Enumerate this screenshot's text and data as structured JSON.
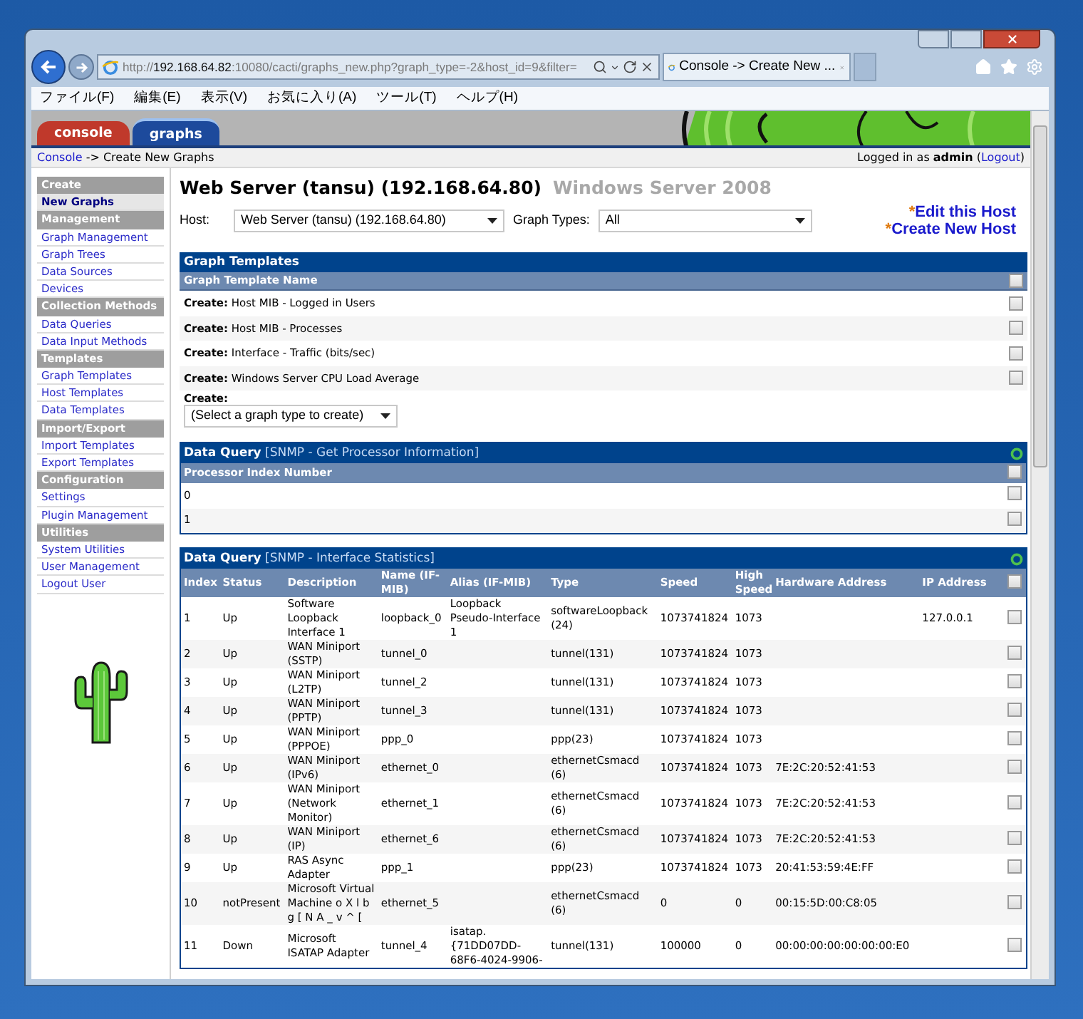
{
  "browser": {
    "address_scheme": "http://",
    "address_host": "192.168.64.82",
    "address_rest": ":10080/cacti/graphs_new.php?graph_type=-2&host_id=9&filter=",
    "tab_title": "Console -> Create New ...",
    "menu": [
      "ファイル(F)",
      "編集(E)",
      "表示(V)",
      "お気に入り(A)",
      "ツール(T)",
      "ヘルプ(H)"
    ]
  },
  "cacti_tabs": [
    {
      "label": "console",
      "color": "#c0392b",
      "selected": false
    },
    {
      "label": "graphs",
      "color": "#1d4a9c",
      "selected": true
    }
  ],
  "breadcrumb": {
    "link": "Console",
    "rest": "-> Create New Graphs"
  },
  "login": {
    "text": "Logged in as **admin** (",
    "logout": "Logout",
    "suffix": ")"
  },
  "sidebar": [
    {
      "kind": "header",
      "label": "Create"
    },
    {
      "kind": "link",
      "label": "New Graphs",
      "selected": true
    },
    {
      "kind": "header",
      "label": "Management"
    },
    {
      "kind": "link",
      "label": "Graph Management",
      "selected": false
    },
    {
      "kind": "link",
      "label": "Graph Trees",
      "selected": false
    },
    {
      "kind": "link",
      "label": "Data Sources",
      "selected": false
    },
    {
      "kind": "link",
      "label": "Devices",
      "selected": false
    },
    {
      "kind": "header",
      "label": "Collection Methods"
    },
    {
      "kind": "link",
      "label": "Data Queries",
      "selected": false
    },
    {
      "kind": "link",
      "label": "Data Input Methods",
      "selected": false
    },
    {
      "kind": "header",
      "label": "Templates"
    },
    {
      "kind": "link",
      "label": "Graph Templates",
      "selected": false
    },
    {
      "kind": "link",
      "label": "Host Templates",
      "selected": false
    },
    {
      "kind": "link",
      "label": "Data Templates",
      "selected": false
    },
    {
      "kind": "header",
      "label": "Import/Export"
    },
    {
      "kind": "link",
      "label": "Import Templates",
      "selected": false
    },
    {
      "kind": "link",
      "label": "Export Templates",
      "selected": false
    },
    {
      "kind": "header",
      "label": "Configuration"
    },
    {
      "kind": "link",
      "label": "Settings",
      "selected": false
    },
    {
      "kind": "link",
      "label": "Plugin Management",
      "selected": false
    },
    {
      "kind": "header",
      "label": "Utilities"
    },
    {
      "kind": "link",
      "label": "System Utilities",
      "selected": false
    },
    {
      "kind": "link",
      "label": "User Management",
      "selected": false
    },
    {
      "kind": "link",
      "label": "Logout User",
      "selected": false
    }
  ],
  "host": {
    "title": "Web Server (tansu) (192.168.64.80)",
    "os": "Windows Server 2008",
    "host_label": "Host:",
    "host_value": "Web Server (tansu) (192.168.64.80)",
    "types_label": "Graph Types:",
    "types_value": "All",
    "links": [
      {
        "mark": "*",
        "label": "Edit this Host"
      },
      {
        "mark": "*",
        "label": "Create New Host"
      }
    ]
  },
  "graph_templates": {
    "title": "Graph Templates",
    "column": "Graph Template Name",
    "select_all_checked": false,
    "rows": [
      {
        "prefix": "Create:",
        "name": "Host MIB - Logged in Users",
        "checked": false
      },
      {
        "prefix": "Create:",
        "name": "Host MIB - Processes",
        "checked": false
      },
      {
        "prefix": "Create:",
        "name": "Interface - Traffic (bits/sec)",
        "checked": false
      },
      {
        "prefix": "Create:",
        "name": "Windows Server CPU Load Average",
        "checked": false
      }
    ],
    "create_label": "Create:",
    "create_value": "(Select a graph type to create)"
  },
  "data_queries": [
    {
      "title": "Data Query",
      "source": "[SNMP - Get Processor Information]",
      "select_all_checked": false,
      "columns": [
        "Processor Index Number"
      ],
      "rows": [
        {
          "cells": [
            "0"
          ],
          "checked": false
        },
        {
          "cells": [
            "1"
          ],
          "checked": false
        }
      ]
    },
    {
      "title": "Data Query",
      "source": "[SNMP - Interface Statistics]",
      "select_all_checked": false,
      "columns": [
        "Index",
        "Status",
        "Description",
        "Name (IF-MIB)",
        "Alias (IF-MIB)",
        "Type",
        "Speed",
        "High Speed",
        "Hardware Address",
        "IP Address"
      ],
      "rows": [
        {
          "cells": [
            "1",
            "Up",
            "Software Loopback Interface 1",
            "loopback_0",
            "Loopback Pseudo-Interface 1",
            "softwareLoopback (24)",
            "1073741824",
            "1073",
            "",
            "127.0.0.1"
          ],
          "checked": false
        },
        {
          "cells": [
            "2",
            "Up",
            "WAN Miniport (SSTP)",
            "tunnel_0",
            "",
            "tunnel(131)",
            "1073741824",
            "1073",
            "",
            ""
          ],
          "checked": false
        },
        {
          "cells": [
            "3",
            "Up",
            "WAN Miniport (L2TP)",
            "tunnel_2",
            "",
            "tunnel(131)",
            "1073741824",
            "1073",
            "",
            ""
          ],
          "checked": false
        },
        {
          "cells": [
            "4",
            "Up",
            "WAN Miniport (PPTP)",
            "tunnel_3",
            "",
            "tunnel(131)",
            "1073741824",
            "1073",
            "",
            ""
          ],
          "checked": false
        },
        {
          "cells": [
            "5",
            "Up",
            "WAN Miniport (PPPOE)",
            "ppp_0",
            "",
            "ppp(23)",
            "1073741824",
            "1073",
            "",
            ""
          ],
          "checked": false
        },
        {
          "cells": [
            "6",
            "Up",
            "WAN Miniport (IPv6)",
            "ethernet_0",
            "",
            "ethernetCsmacd (6)",
            "1073741824",
            "1073",
            "7E:2C:20:52:41:53",
            ""
          ],
          "checked": false
        },
        {
          "cells": [
            "7",
            "Up",
            "WAN Miniport (Network Monitor)",
            "ethernet_1",
            "",
            "ethernetCsmacd (6)",
            "1073741824",
            "1073",
            "7E:2C:20:52:41:53",
            ""
          ],
          "checked": false
        },
        {
          "cells": [
            "8",
            "Up",
            "WAN Miniport (IP)",
            "ethernet_6",
            "",
            "ethernetCsmacd (6)",
            "1073741824",
            "1073",
            "7E:2C:20:52:41:53",
            ""
          ],
          "checked": false
        },
        {
          "cells": [
            "9",
            "Up",
            "RAS Async Adapter",
            "ppp_1",
            "",
            "ppp(23)",
            "1073741824",
            "1073",
            "20:41:53:59:4E:FF",
            ""
          ],
          "checked": false
        },
        {
          "cells": [
            "10",
            "notPresent",
            "Microsoft Virtual Machine o X l b g [ N A _ v ^ [",
            "ethernet_5",
            "",
            "ethernetCsmacd (6)",
            "0",
            "0",
            "00:15:5D:00:C8:05",
            ""
          ],
          "checked": false
        },
        {
          "cells": [
            "11",
            "Down",
            "Microsoft ISATAP Adapter",
            "tunnel_4",
            "isatap.{71DD07DD-68F6-4024-9906-",
            "tunnel(131)",
            "100000",
            "0",
            "00:00:00:00:00:00:00:E0",
            ""
          ],
          "checked": false
        }
      ]
    }
  ]
}
